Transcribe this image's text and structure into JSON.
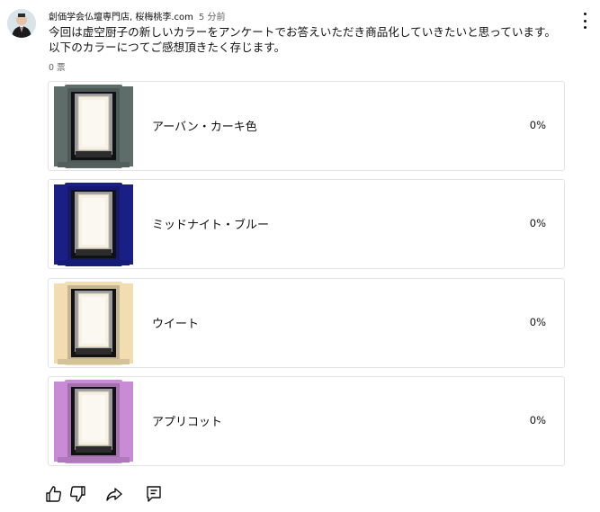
{
  "post": {
    "author": "創価学会仏壇専門店, 桜梅桃李.com",
    "time": "5 分前",
    "text_line1": "今回は虚空厨子の新しいカラーをアンケートでお答えいただき商品化していきたいと思っています。",
    "text_line2": "以下のカラーにつてご感想頂きたく存じます。",
    "votes": "0 票"
  },
  "poll": {
    "options": [
      {
        "label": "アーバン・カーキ色",
        "percent": "0%",
        "color": "#5f6d6a"
      },
      {
        "label": "ミッドナイト・ブルー",
        "percent": "0%",
        "color": "#1a1f86"
      },
      {
        "label": "ウイート",
        "percent": "0%",
        "color": "#f1ddb0"
      },
      {
        "label": "アプリコット",
        "percent": "0%",
        "color": "#c98ad6"
      }
    ]
  },
  "actions": {
    "icons": [
      "thumbs-up-icon",
      "thumbs-down-icon",
      "share-icon",
      "reply-icon"
    ]
  }
}
